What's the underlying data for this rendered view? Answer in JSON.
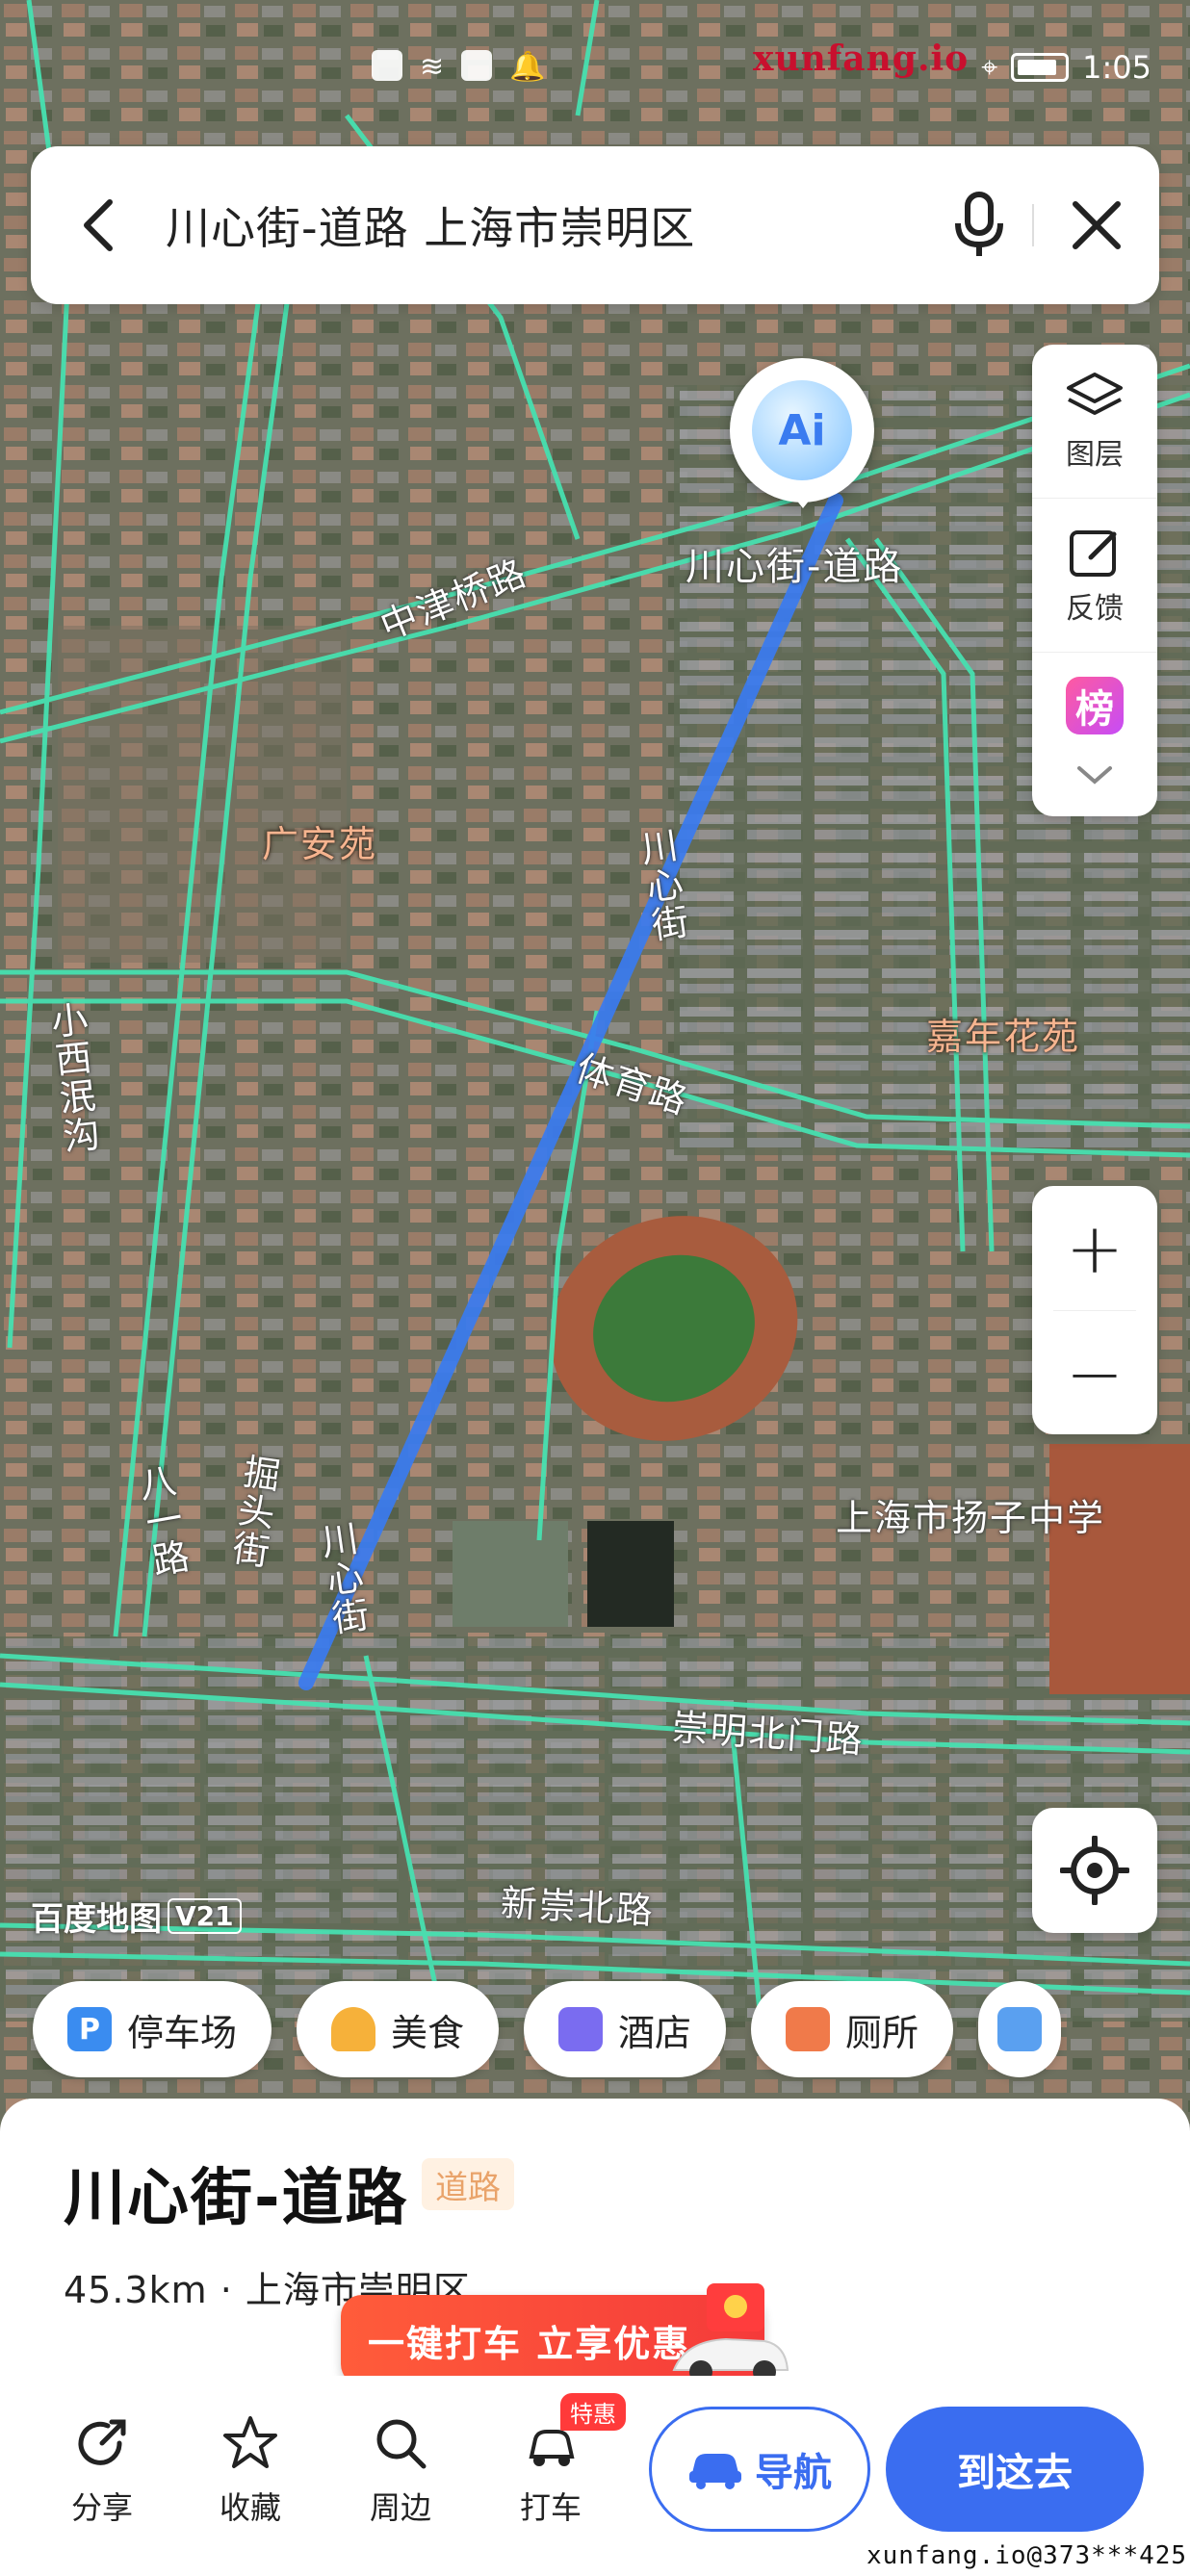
{
  "status_bar": {
    "time": "1:05",
    "watermark": "xunfang.io"
  },
  "search": {
    "query": "川心街-道路 上海市崇明区"
  },
  "map": {
    "marker_label": "川心街-道路",
    "ai_badge": "Ai",
    "road_labels": [
      "中津桥路",
      "川心街",
      "体育路",
      "崇明北门路",
      "新崇北路",
      "八一路",
      "掘头街",
      "川心街",
      "小西泯沟"
    ],
    "poi_labels": [
      "广安苑",
      "嘉年花苑"
    ],
    "landmark_labels": [
      "上海市扬子中学"
    ],
    "baidu_logo": "百度地图",
    "baidu_version": "V21"
  },
  "tools": {
    "layers_label": "图层",
    "feedback_label": "反馈",
    "rank_glyph": "榜"
  },
  "zoom": {
    "plus": "+",
    "minus": "−"
  },
  "chips": [
    {
      "label": "停车场",
      "icon": "parking-icon",
      "glyph": "P",
      "color": "#3a8cf0"
    },
    {
      "label": "美食",
      "icon": "food-icon",
      "glyph": "",
      "color": "#f6b13a"
    },
    {
      "label": "酒店",
      "icon": "hotel-icon",
      "glyph": "",
      "color": "#7a6cf0"
    },
    {
      "label": "厕所",
      "icon": "toilet-icon",
      "glyph": "",
      "color": "#f07a4a"
    }
  ],
  "place": {
    "title": "川心街-道路",
    "tag": "道路",
    "meta": "45.3km · 上海市崇明区"
  },
  "promo": {
    "text": "一键打车 立享优惠"
  },
  "actions": {
    "share": "分享",
    "favorite": "收藏",
    "nearby": "周边",
    "taxi": "打车",
    "special_badge": "特惠",
    "navigate": "导航",
    "go_here": "到这去"
  },
  "footer_watermark": "xunfang.io@373***425",
  "colors": {
    "accent": "#3a6df0",
    "route": "#3a7bf0",
    "road": "#47e0b0"
  }
}
